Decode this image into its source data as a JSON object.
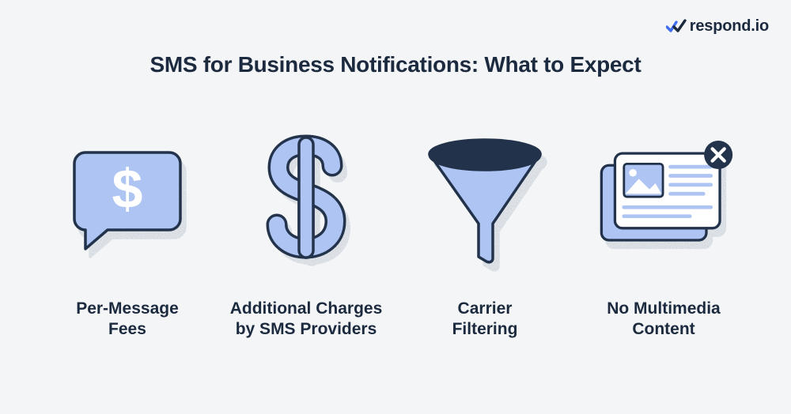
{
  "brand": {
    "name": "respond.io"
  },
  "title": "SMS for Business Notifications: What to Expect",
  "items": [
    {
      "icon": "chat-dollar-icon",
      "caption": "Per-Message\nFees"
    },
    {
      "icon": "dollar-icon",
      "caption": "Additional Charges\nby SMS Providers"
    },
    {
      "icon": "funnel-icon",
      "caption": "Carrier\nFiltering"
    },
    {
      "icon": "no-multimedia-icon",
      "caption": "No Multimedia\nContent"
    }
  ],
  "colors": {
    "light_blue": "#aec4f3",
    "dark_navy": "#22334b",
    "brand_blue": "#3d6df5",
    "white": "#ffffff",
    "bg": "#f4f5f6"
  }
}
